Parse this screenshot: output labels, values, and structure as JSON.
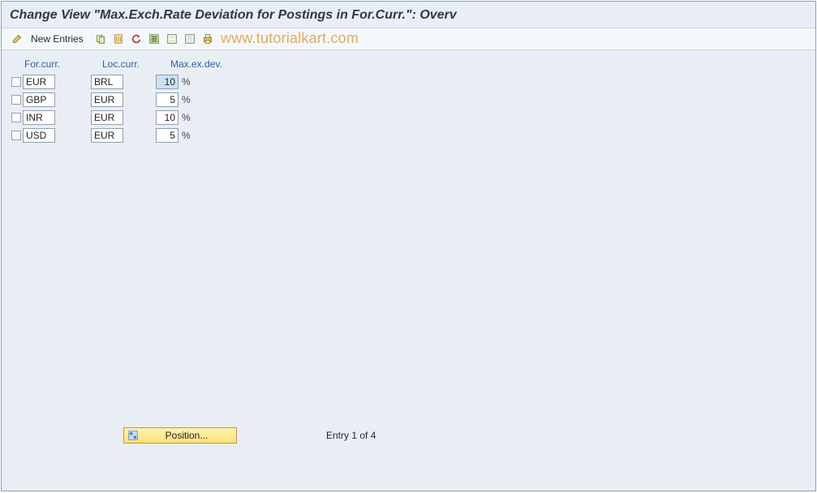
{
  "title": "Change View \"Max.Exch.Rate Deviation for Postings in For.Curr.\": Overv",
  "toolbar": {
    "new_entries": "New Entries"
  },
  "watermark": "www.tutorialkart.com",
  "columns": {
    "for_curr": "For.curr.",
    "loc_curr": "Loc.curr.",
    "max_dev": "Max.ex.dev."
  },
  "percent_sign": "%",
  "rows": [
    {
      "for_curr": "EUR",
      "loc_curr": "BRL",
      "max_dev": "10",
      "selected": true
    },
    {
      "for_curr": "GBP",
      "loc_curr": "EUR",
      "max_dev": "5",
      "selected": false
    },
    {
      "for_curr": "INR",
      "loc_curr": "EUR",
      "max_dev": "10",
      "selected": false
    },
    {
      "for_curr": "USD",
      "loc_curr": "EUR",
      "max_dev": "5",
      "selected": false
    }
  ],
  "footer": {
    "position_label": "Position...",
    "entry_text": "Entry 1 of 4"
  }
}
